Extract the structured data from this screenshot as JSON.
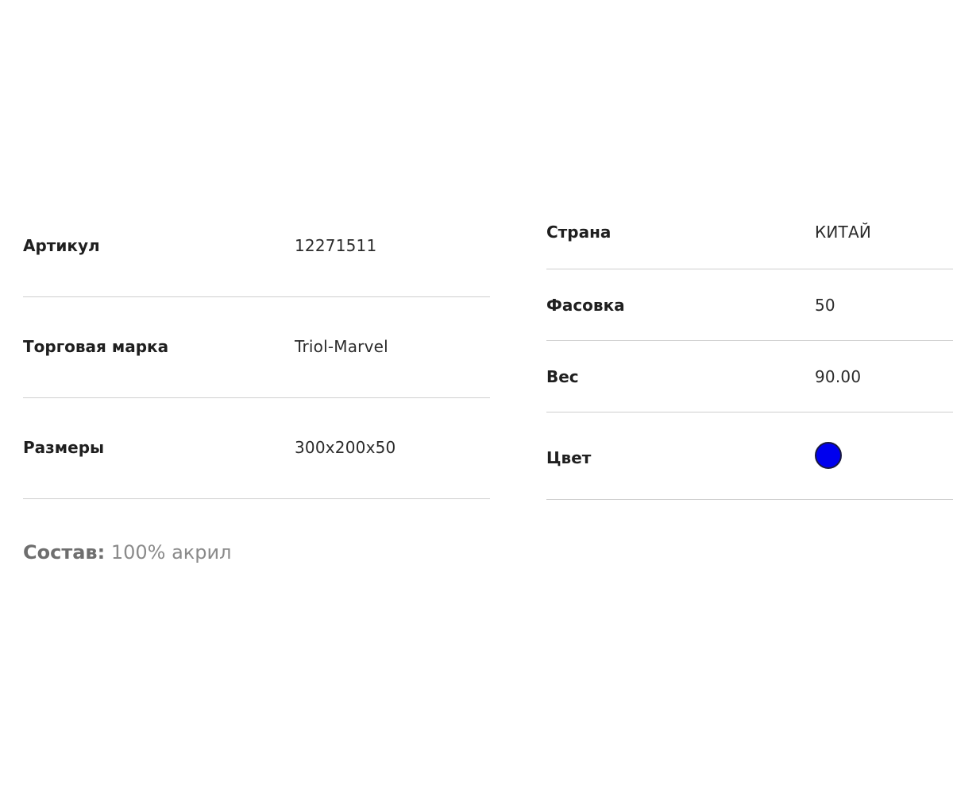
{
  "specs_left": [
    {
      "label": "Артикул",
      "value": "12271511"
    },
    {
      "label": "Торговая марка",
      "value": "Triol-Marvel"
    },
    {
      "label": "Размеры",
      "value": "300x200x50"
    }
  ],
  "specs_right": [
    {
      "label": "Страна",
      "value": "КИТАЙ"
    },
    {
      "label": "Фасовка",
      "value": "50"
    },
    {
      "label": "Вес",
      "value": "90.00"
    },
    {
      "label": "Цвет",
      "swatch_color": "#0000ee"
    }
  ],
  "composition": {
    "label": "Состав:",
    "value": " 100% акрил"
  }
}
